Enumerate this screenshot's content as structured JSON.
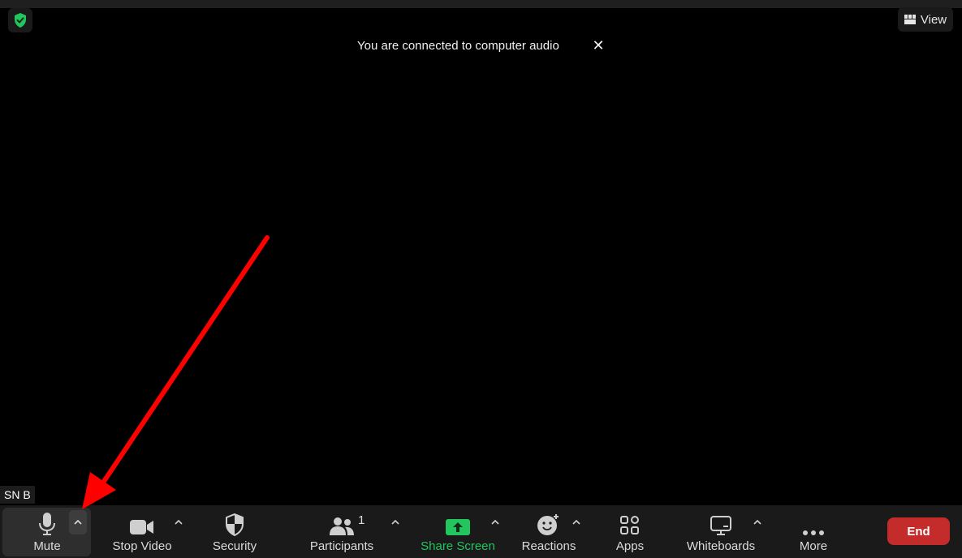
{
  "header": {
    "view_label": "View",
    "security_badge_color": "#22c55e"
  },
  "notification": {
    "message": "You are connected to computer audio",
    "close_glyph": "✕"
  },
  "participant": {
    "name_tag": "SN B"
  },
  "toolbar": {
    "mute_label": "Mute",
    "stop_video_label": "Stop Video",
    "security_label": "Security",
    "participants_label": "Participants",
    "participants_count": "1",
    "share_screen_label": "Share Screen",
    "share_screen_color": "#22c55e",
    "reactions_label": "Reactions",
    "apps_label": "Apps",
    "whiteboards_label": "Whiteboards",
    "more_label": "More",
    "end_label": "End",
    "end_color": "#c42b2b"
  },
  "annotation": {
    "arrow_color": "#ff0000",
    "points_to": "mute-options-caret"
  }
}
